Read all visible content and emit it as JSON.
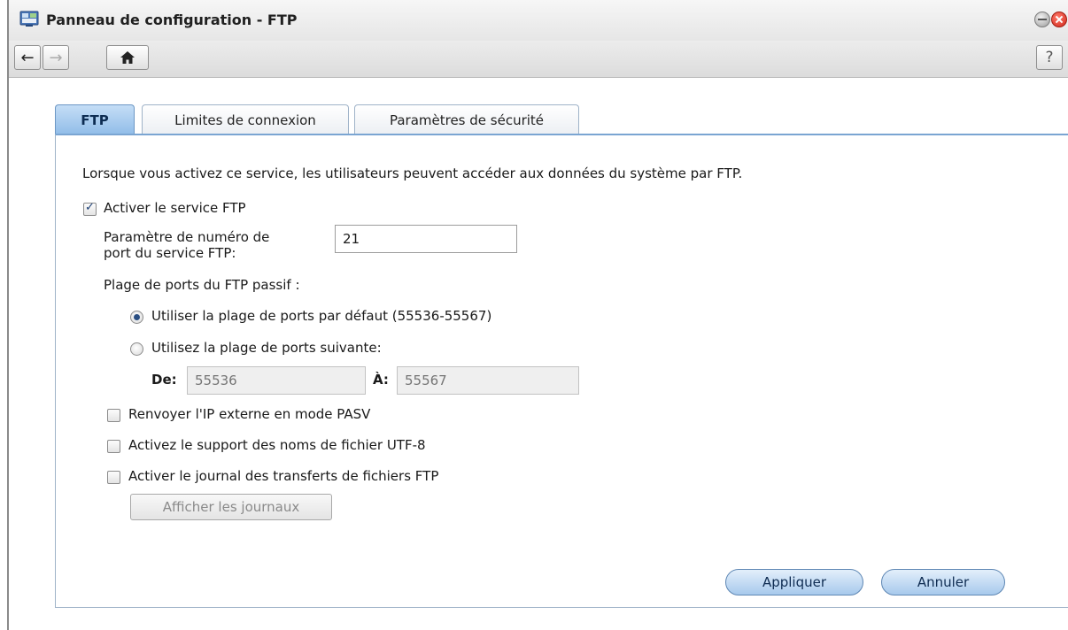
{
  "window": {
    "title": "Panneau de configuration - FTP"
  },
  "toolbar": {
    "back": "←",
    "forward": "→",
    "home": "⌂",
    "help": "?"
  },
  "tabs": [
    {
      "label": "FTP",
      "active": true
    },
    {
      "label": "Limites de connexion",
      "active": false
    },
    {
      "label": "Paramètres de sécurité",
      "active": false
    }
  ],
  "panel": {
    "description": "Lorsque vous activez ce service, les utilisateurs peuvent accéder aux données du système par FTP.",
    "enable_ftp": {
      "label": "Activer le service FTP",
      "checked": true
    },
    "port": {
      "label_line1": "Paramètre de numéro de",
      "label_line2": "port du service FTP:",
      "value": "21"
    },
    "passive_range": {
      "label": "Plage de ports du FTP passif :",
      "default_option": {
        "label": "Utiliser la plage de ports par défaut (55536-55567)",
        "selected": true
      },
      "custom_option": {
        "label": "Utilisez la plage de ports suivante:",
        "selected": false
      },
      "from_label": "De:",
      "from_placeholder": "55536",
      "to_label": "À:",
      "to_placeholder": "55567"
    },
    "pasv_external_ip": {
      "label": "Renvoyer l'IP externe en mode PASV",
      "checked": false
    },
    "utf8_support": {
      "label": "Activez le support des noms de fichier UTF-8",
      "checked": false
    },
    "transfer_log": {
      "label": "Activer le journal des transferts de fichiers FTP",
      "checked": false
    },
    "view_logs_button": "Afficher les journaux",
    "apply_button": "Appliquer",
    "cancel_button": "Annuler"
  },
  "colors": {
    "tab_active": "#8fbce8",
    "panel_border": "#7aa5d2",
    "close_button": "#d0281c"
  }
}
